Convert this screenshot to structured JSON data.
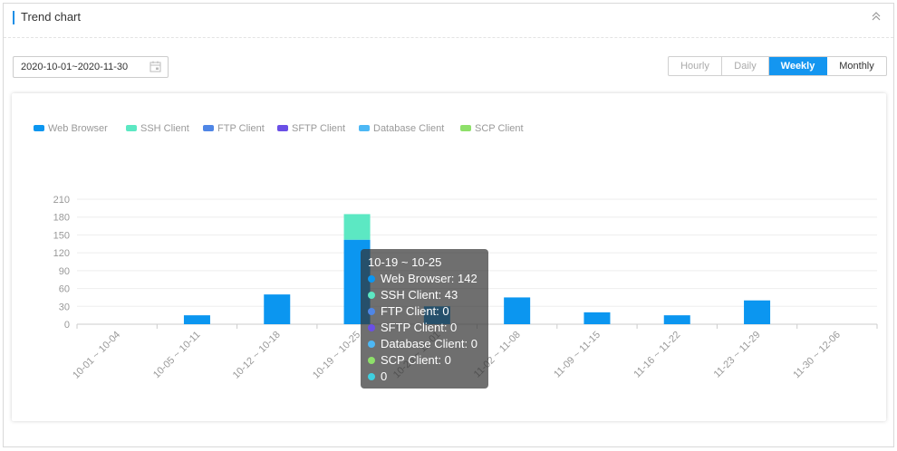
{
  "panel": {
    "title": "Trend chart"
  },
  "date_range": {
    "value": "2020-10-01~2020-11-30"
  },
  "period_tabs": [
    {
      "label": "Hourly",
      "active": false
    },
    {
      "label": "Daily",
      "active": false
    },
    {
      "label": "Weekly",
      "active": true
    },
    {
      "label": "Monthly",
      "active": false
    }
  ],
  "chart_data": {
    "type": "bar",
    "stacked": true,
    "categories": [
      "10-01 ~ 10-04",
      "10-05 ~ 10-11",
      "10-12 ~ 10-18",
      "10-19 ~ 10-25",
      "10-26 ~ 11-01",
      "11-02 ~ 11-08",
      "11-09 ~ 11-15",
      "11-16 ~ 11-22",
      "11-23 ~ 11-29",
      "11-30 ~ 12-06"
    ],
    "series": [
      {
        "name": "Web Browser",
        "color": "#0b96f0",
        "values": [
          0,
          15,
          50,
          142,
          30,
          45,
          20,
          15,
          40,
          0
        ]
      },
      {
        "name": "SSH Client",
        "color": "#5ce8c3",
        "values": [
          0,
          0,
          0,
          43,
          0,
          0,
          0,
          0,
          0,
          0
        ]
      },
      {
        "name": "FTP Client",
        "color": "#4f86e6",
        "values": [
          0,
          0,
          0,
          0,
          0,
          0,
          0,
          0,
          0,
          0
        ]
      },
      {
        "name": "SFTP Client",
        "color": "#6a4fe6",
        "values": [
          0,
          0,
          0,
          0,
          0,
          0,
          0,
          0,
          0,
          0
        ]
      },
      {
        "name": "Database Client",
        "color": "#4db8f5",
        "values": [
          0,
          0,
          0,
          0,
          0,
          0,
          0,
          0,
          0,
          0
        ]
      },
      {
        "name": "SCP Client",
        "color": "#8ee06a",
        "values": [
          0,
          0,
          0,
          0,
          0,
          0,
          0,
          0,
          0,
          0
        ]
      }
    ],
    "ylim": [
      0,
      210
    ],
    "yticks": [
      0,
      30,
      60,
      90,
      120,
      150,
      180,
      210
    ],
    "grid": true,
    "legend": "top-left",
    "tooltip": {
      "title": "10-19 ~ 10-25",
      "rows": [
        {
          "text": "Web Browser: 142",
          "color": "#0b96f0"
        },
        {
          "text": "SSH Client: 43",
          "color": "#5ce8c3"
        },
        {
          "text": "FTP Client: 0",
          "color": "#4f86e6"
        },
        {
          "text": "SFTP Client: 0",
          "color": "#6a4fe6"
        },
        {
          "text": "Database Client: 0",
          "color": "#4db8f5"
        },
        {
          "text": "SCP Client: 0",
          "color": "#8ee06a"
        },
        {
          "text": "0",
          "color": "#3fd0e0"
        }
      ]
    }
  }
}
